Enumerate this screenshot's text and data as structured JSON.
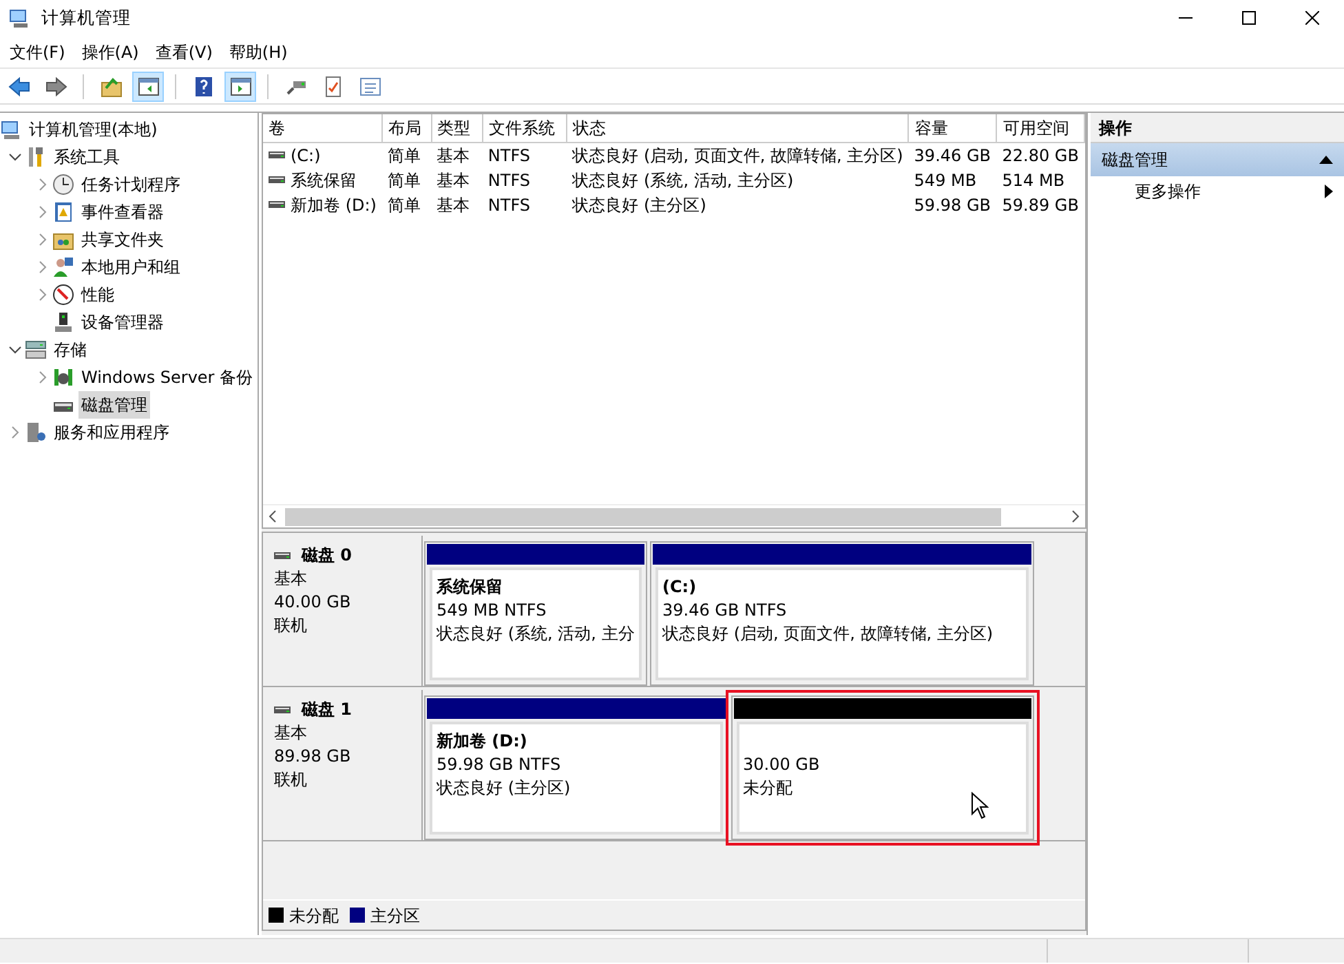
{
  "window": {
    "title": "计算机管理"
  },
  "menu": [
    "文件(F)",
    "操作(A)",
    "查看(V)",
    "帮助(H)"
  ],
  "toolbar": [
    {
      "kind": "back",
      "pressed": false
    },
    {
      "kind": "forward",
      "pressed": false
    },
    {
      "kind": "up",
      "pressed": false
    },
    {
      "kind": "pane-left",
      "pressed": true
    },
    {
      "kind": "help",
      "pressed": false
    },
    {
      "kind": "pane-right",
      "pressed": true
    },
    {
      "kind": "connect",
      "pressed": false
    },
    {
      "kind": "check",
      "pressed": false
    },
    {
      "kind": "list",
      "pressed": false
    }
  ],
  "tree": [
    {
      "label": "计算机管理(本地)",
      "kind": "computer",
      "selected": false,
      "children": [
        {
          "label": "系统工具",
          "kind": "tools",
          "expanded": true,
          "selected": false,
          "children": [
            {
              "label": "任务计划程序",
              "kind": "clock",
              "expanded": false,
              "selected": false
            },
            {
              "label": "事件查看器",
              "kind": "event",
              "expanded": false,
              "selected": false
            },
            {
              "label": "共享文件夹",
              "kind": "share",
              "expanded": false,
              "selected": false
            },
            {
              "label": "本地用户和组",
              "kind": "users",
              "expanded": false,
              "selected": false
            },
            {
              "label": "性能",
              "kind": "perf",
              "expanded": false,
              "selected": false
            },
            {
              "label": "设备管理器",
              "kind": "device",
              "selected": false
            }
          ]
        },
        {
          "label": "存储",
          "kind": "storage",
          "expanded": true,
          "selected": false,
          "children": [
            {
              "label": "Windows Server 备份",
              "kind": "backup",
              "expanded": false,
              "selected": false
            },
            {
              "label": "磁盘管理",
              "kind": "disk",
              "selected": true
            }
          ]
        },
        {
          "label": "服务和应用程序",
          "kind": "services",
          "expanded": false,
          "selected": false
        }
      ]
    }
  ],
  "volumes": {
    "columns": [
      "卷",
      "布局",
      "类型",
      "文件系统",
      "状态",
      "容量",
      "可用空间"
    ],
    "rows": [
      [
        "(C:)",
        "简单",
        "基本",
        "NTFS",
        "状态良好 (启动, 页面文件, 故障转储, 主分区)",
        "39.46 GB",
        "22.80 GB"
      ],
      [
        "系统保留",
        "简单",
        "基本",
        "NTFS",
        "状态良好 (系统, 活动, 主分区)",
        "549 MB",
        "514 MB"
      ],
      [
        "新加卷 (D:)",
        "简单",
        "基本",
        "NTFS",
        "状态良好 (主分区)",
        "59.98 GB",
        "59.89 GB"
      ]
    ]
  },
  "disks": [
    {
      "name": "磁盘 0",
      "type": "基本",
      "size": "40.00 GB",
      "status": "联机",
      "partitions": [
        {
          "title": "系统保留",
          "size": "549 MB NTFS",
          "status": "状态良好 (系统, 活动, 主分",
          "color": "#000080",
          "selected": false
        },
        {
          "title": "(C:)",
          "size": "39.46 GB NTFS",
          "status": "状态良好 (启动, 页面文件, 故障转储, 主分区)",
          "color": "#000080",
          "selected": false
        }
      ]
    },
    {
      "name": "磁盘 1",
      "type": "基本",
      "size": "89.98 GB",
      "status": "联机",
      "partitions": [
        {
          "title": "新加卷  (D:)",
          "size": "59.98 GB NTFS",
          "status": "状态良好 (主分区)",
          "color": "#000080",
          "selected": false
        },
        {
          "size": "30.00 GB",
          "status": "未分配",
          "color": "#000000",
          "selected": true
        }
      ]
    }
  ],
  "legend": [
    {
      "label": "未分配",
      "color": "#000000"
    },
    {
      "label": "主分区",
      "color": "#000080"
    }
  ],
  "actions": {
    "title": "操作",
    "section": "磁盘管理",
    "expanded": true,
    "items": [
      "更多操作"
    ]
  }
}
